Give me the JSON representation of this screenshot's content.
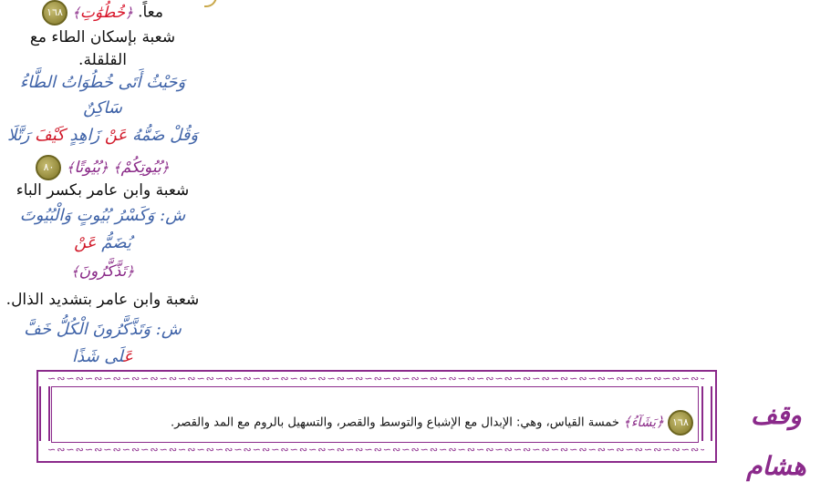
{
  "lines": {
    "l1_word": "خُطُوَٰتِ",
    "l1_badge": "١٦٨",
    "l1_text": "معاً.",
    "l2": "شعبة بإسكان الطاء مع",
    "l3": "القلقلة.",
    "l4": "وَحَيْثُ أَتَى خُطُوَاتُ الطَّاءُ",
    "l5": "سَاكِنٌ",
    "l6a": "وَقُلْ ضَمُّهُ ",
    "l6b": "عَنْ",
    "l6c": " زَاهِدٍ ",
    "l6d": "كَيْفَ",
    "l6e": " رَتَّلَا",
    "l7_word1": "بُيُوتًا",
    "l7_word2": "بُيُوتِكُمْ",
    "l7_badge": "٨٠",
    "l8": "شعبة وابن عامر بكسر الباء",
    "l9": "ش: وَكَسْرُ بُيُوتٍ وَالْبُيُوتَ",
    "l10a": "يُضَمُّ ",
    "l10b": "عَنْ",
    "l11_word": "تَذَّكَّرُونَ",
    "l12": "شعبة وابن عامر بتشديد الذال.",
    "l13": "ش: وَتَذَّكَّرُونَ الْكُلُّ خَفَّ",
    "l14a": "عَ",
    "l14b": "لَى شَذًا"
  },
  "bottom": {
    "title": "وقف هشام",
    "badge": "١٦٨",
    "word": "يَشَآءُ",
    "text": "خمسة القياس، وهي: الإبدال مع الإشباع والتوسط والقصر، والتسهيل بالروم مع المد والقصر."
  },
  "colors": {
    "blue": "#3f63a8",
    "red": "#d11a2a",
    "purple": "#8b2a8b",
    "badge": "#7e7424"
  }
}
